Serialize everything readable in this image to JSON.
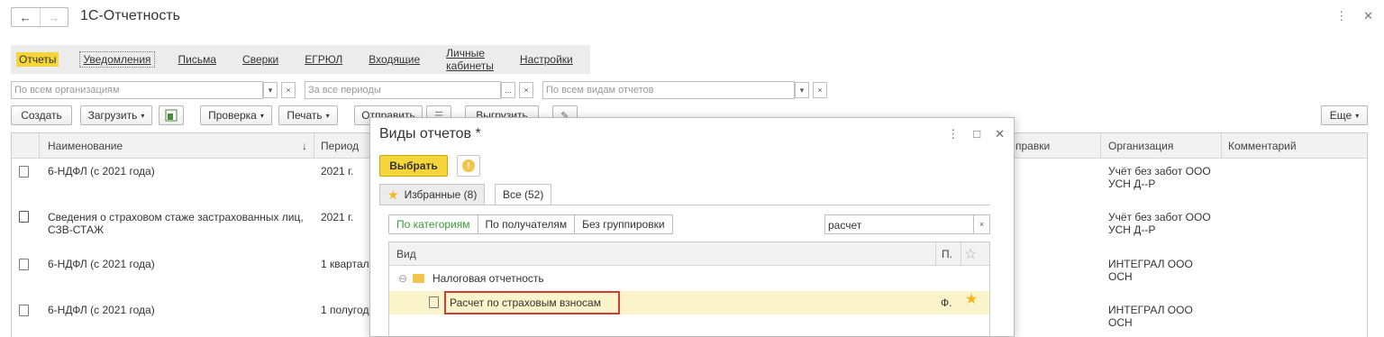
{
  "header": {
    "back": "←",
    "forward": "→",
    "title": "1С-Отчетность",
    "more": "⋮",
    "close": "✕"
  },
  "tabs": [
    "Отчеты",
    "Уведомления",
    "Письма",
    "Сверки",
    "ЕГРЮЛ",
    "Входящие",
    "Личные кабинеты",
    "Настройки"
  ],
  "filters": {
    "org": "По всем организациям",
    "period": "За все периоды",
    "kind": "По всем видам отчетов",
    "dropdown": "▾",
    "clear": "×",
    "ellipsis": "..."
  },
  "toolbar": {
    "create": "Создать",
    "load": "Загрузить",
    "check": "Проверка",
    "print": "Печать",
    "send": "Отправить",
    "upload": "Выгрузить",
    "more": "Еще"
  },
  "grid": {
    "columns": {
      "name": "Наименование",
      "period": "Период",
      "correction": "правки",
      "org": "Организация",
      "comment": "Комментарий"
    },
    "sort_arrow": "↓",
    "rows": [
      {
        "name": "6-НДФЛ (с 2021 года)",
        "period": "2021 г.",
        "org1": "Учёт без забот ООО",
        "org2": "УСН Д--Р"
      },
      {
        "name": "Сведения о страховом стаже застрахованных лиц,",
        "name2": "СЗВ-СТАЖ",
        "period": "2021 г.",
        "org1": "Учёт без забот ООО",
        "org2": "УСН Д--Р"
      },
      {
        "name": "6-НДФЛ (с 2021 года)",
        "period": "1 квартал",
        "org1": "ИНТЕГРАЛ ООО",
        "org2": "ОСН"
      },
      {
        "name": "6-НДФЛ (с 2021 года)",
        "period": "1 полугод",
        "org1": "ИНТЕГРАЛ ООО",
        "org2": "ОСН"
      }
    ]
  },
  "dialog": {
    "title": "Виды отчетов *",
    "choose": "Выбрать",
    "info": "!",
    "tab_fav": "Избранные (8)",
    "tab_all": "Все (52)",
    "grouping": [
      "По категориям",
      "По получателям",
      "Без группировки"
    ],
    "search_value": "расчет",
    "search_clear": "×",
    "col_kind": "Вид",
    "col_p": "П.",
    "group": "Налоговая отчетность",
    "group_toggle": "⊖",
    "item": "Расчет по страховым взносам",
    "item_p": "Ф.",
    "icons": {
      "more": "⋮",
      "maximize": "□",
      "close": "✕"
    }
  },
  "colors": {
    "accent": "#f5d53a",
    "selected_row": "#fbf3c9",
    "highlight_frame": "#d23b3b",
    "star": "#f3b61f"
  }
}
